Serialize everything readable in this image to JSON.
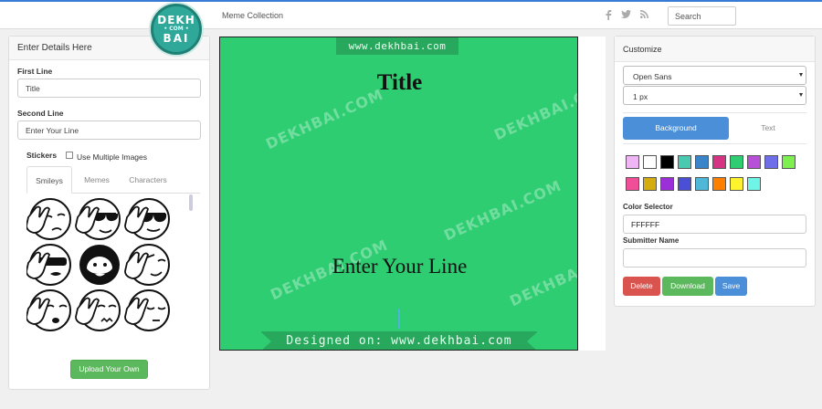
{
  "topbar": {
    "logo": {
      "line1": "DEKH",
      "line2": "• COM •",
      "line3": "BAI"
    },
    "brand": "Meme Collection",
    "social": [
      "facebook-icon",
      "twitter-icon",
      "rss-icon"
    ],
    "search_placeholder": "Search"
  },
  "left": {
    "header": "Enter Details Here",
    "first_line_label": "First Line",
    "first_line_value": "Title",
    "second_line_label": "Second Line",
    "second_line_value": "Enter Your Line",
    "stickers_label": "Stickers",
    "multiple_images_label": "Use Multiple Images",
    "tabs": [
      {
        "label": "Smileys",
        "active": true
      },
      {
        "label": "Memes",
        "active": false
      },
      {
        "label": "Characters",
        "active": false
      }
    ],
    "stickers": [
      "facepalm-sad-icon",
      "facepalm-sunglasses-icon",
      "facepalm-sunglasses-mustache-icon",
      "facepalm-dark-glasses-icon",
      "bearded-man-icon",
      "facepalm-wink-icon",
      "facepalm-shock-icon",
      "facepalm-annoyed-icon",
      "facepalm-sleepy-icon"
    ],
    "upload_label": "Upload Your Own"
  },
  "canvas": {
    "watermark_top": "www.dekhbai.com",
    "watermark_repeat": "DEKHBAI.COM",
    "title": "Title",
    "line": "Enter Your Line",
    "watermark_bottom": "Designed on:  www.dekhbai.com",
    "background_color": "#2ecd72"
  },
  "right": {
    "header": "Customize",
    "font_value": "Open Sans",
    "stroke_value": "1 px",
    "tab_background": "Background",
    "tab_text": "Text",
    "swatches": [
      "#f0b5f5",
      "#ffffff",
      "#000000",
      "#48c9b0",
      "#3a84c9",
      "#d63384",
      "#2ecd72",
      "#b84fd8",
      "#6f6ee8",
      "#7df04f",
      "#f04f97",
      "#d4ac0d",
      "#9b30d9",
      "#4a4fd6",
      "#4fb8d9",
      "#ff7f00",
      "#fff22e",
      "#6ff5e8"
    ],
    "color_selector_label": "Color Selector",
    "color_value": "FFFFFF",
    "submitter_label": "Submitter Name",
    "submitter_value": "",
    "delete_label": "Delete",
    "download_label": "Download",
    "save_label": "Save",
    "colors": {
      "delete": "#d9534f",
      "download": "#5cb85c",
      "save": "#4a8fd8"
    }
  }
}
